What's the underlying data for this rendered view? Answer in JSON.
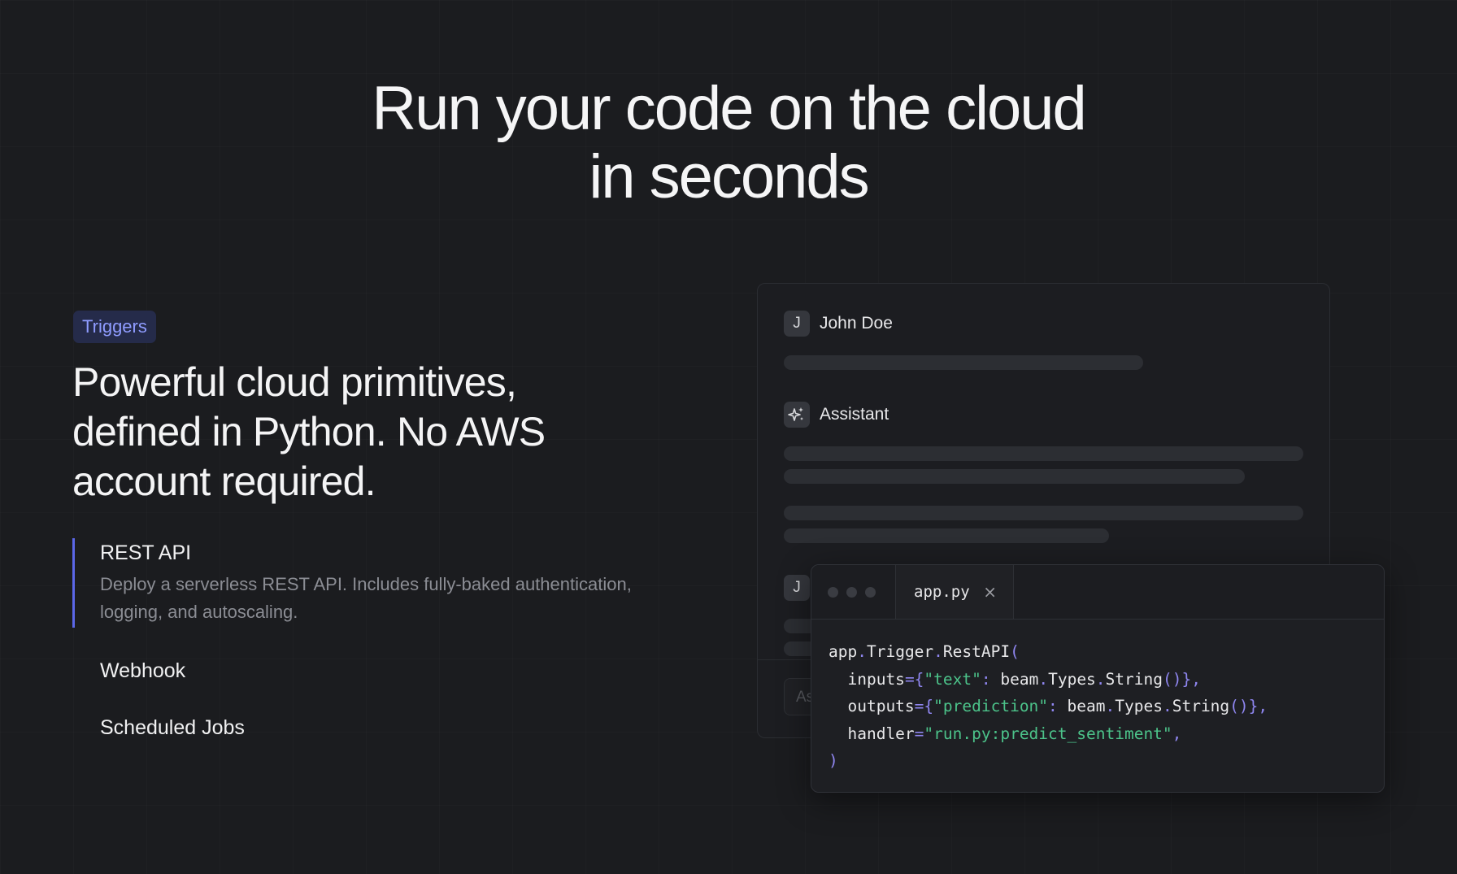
{
  "hero": {
    "line1": "Run your code on the cloud",
    "line2": "in seconds"
  },
  "badge": "Triggers",
  "heading": {
    "line1": "Powerful cloud primitives,",
    "line2": "defined in Python. No AWS",
    "line3": "account required."
  },
  "features": [
    {
      "title": "REST API",
      "desc_line1": "Deploy a serverless REST API. Includes fully-baked authentication,",
      "desc_line2": "logging, and autoscaling."
    },
    {
      "title": "Webhook"
    },
    {
      "title": "Scheduled Jobs"
    }
  ],
  "chat": {
    "user_initial": "J",
    "user_name": "John Doe",
    "assistant_name": "Assistant",
    "input_placeholder": "As"
  },
  "editor": {
    "tab_label": "app.py",
    "close_glyph": "×",
    "code": {
      "l1a": "app",
      "l1b": "Trigger",
      "l1c": "RestAPI",
      "l2_kw": "inputs",
      "l2_key": "\"text\"",
      "l2_beam": "beam",
      "l2_types": "Types",
      "l2_str": "String",
      "l3_kw": "outputs",
      "l3_key": "\"prediction\"",
      "l3_beam": "beam",
      "l3_types": "Types",
      "l3_str": "String",
      "l4_kw": "handler",
      "l4_val": "\"run.py:predict_sentiment\""
    }
  },
  "colors": {
    "background": "#1b1c1f",
    "accent": "#5b67e8",
    "badge_text": "#8f9cff",
    "code_string": "#4cc38a",
    "code_punct": "#8f86f0"
  }
}
